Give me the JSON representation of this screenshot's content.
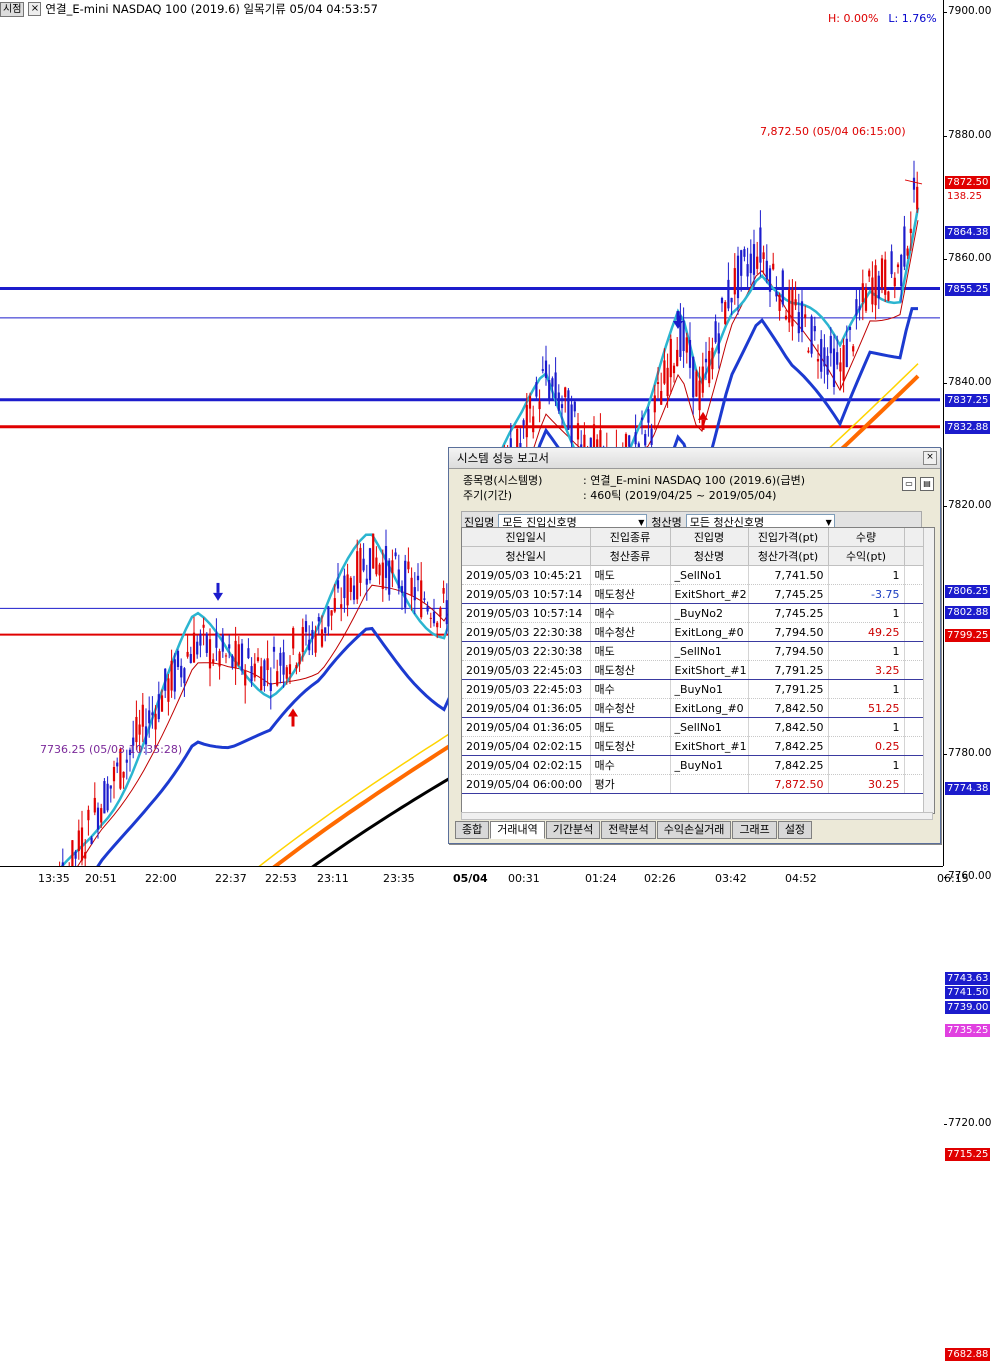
{
  "window": {
    "tag": "시점",
    "close": "×",
    "title": "연결_E-mini NASDAQ 100 (2019.6) 일목기류  05/04 04:53:57"
  },
  "hl": {
    "high": "H: 0.00%",
    "low": "L: 1.76%"
  },
  "annotations": {
    "last_price": "7,872.50 (05/04 06:15:00)",
    "low_price": "7736.25 (05/03 10:35:28)"
  },
  "y_axis": {
    "labels": [
      "7900.00",
      "7880.00",
      "7860.00",
      "7840.00",
      "7820.00",
      "7780.00",
      "7760.00",
      "7720.00"
    ],
    "badges": [
      {
        "text": "7872.50",
        "color": "#e00000"
      },
      {
        "text": "138.25",
        "color": "#ffffff"
      },
      {
        "text": "7864.38",
        "color": "#1c1ccc"
      },
      {
        "text": "7855.25",
        "color": "#1c1ccc"
      },
      {
        "text": "7837.25",
        "color": "#1c1ccc"
      },
      {
        "text": "7832.88",
        "color": "#1c1ccc"
      },
      {
        "text": "7806.25",
        "color": "#1c1ccc"
      },
      {
        "text": "7802.88",
        "color": "#1c1ccc"
      },
      {
        "text": "7799.25",
        "color": "#e00000"
      },
      {
        "text": "7774.38",
        "color": "#1c1ccc"
      },
      {
        "text": "7743.63",
        "color": "#1c1ccc"
      },
      {
        "text": "7741.50",
        "color": "#1c1ccc"
      },
      {
        "text": "7739.00",
        "color": "#1c1ccc"
      },
      {
        "text": "7735.25",
        "color": "#e040e0"
      },
      {
        "text": "7715.25",
        "color": "#e00000"
      },
      {
        "text": "7682.88",
        "color": "#e00000"
      }
    ]
  },
  "x_axis": {
    "labels": [
      "13:35",
      "20:51",
      "22:00",
      "22:37",
      "22:53",
      "23:11",
      "23:35",
      "05/04",
      "00:31",
      "01:24",
      "02:26",
      "03:42",
      "04:52"
    ],
    "corner": "06:15"
  },
  "dialog": {
    "title": "시스템 성능 보고서",
    "close": "×",
    "item_key": "종목명(시스템명)",
    "item_val": ": 연결_E-mini NASDAQ 100 (2019.6)(급변)",
    "period_key": "주기(기간)",
    "period_val": ": 460틱 (2019/04/25 ~ 2019/05/04)",
    "entry_label": "진입명",
    "entry_value": "모든 진입신호명",
    "exit_label": "청산명",
    "exit_value": "모든 청산신호명",
    "headers_top": [
      "진입일시",
      "진입종류",
      "진입명",
      "진입가격(pt)",
      "수량"
    ],
    "headers_bottom": [
      "청산일시",
      "청산종류",
      "청산명",
      "청산가격(pt)",
      "수익(pt)"
    ],
    "rows": [
      [
        "2019/05/03 10:45:21",
        "매도",
        "_SellNo1",
        "7,741.50",
        "1",
        ""
      ],
      [
        "2019/05/03 10:57:14",
        "매도청산",
        "ExitShort_#2",
        "7,745.25",
        "-3.75",
        "neg"
      ],
      [
        "2019/05/03 10:57:14",
        "매수",
        "_BuyNo2",
        "7,745.25",
        "1",
        ""
      ],
      [
        "2019/05/03 22:30:38",
        "매수청산",
        "ExitLong_#0",
        "7,794.50",
        "49.25",
        "pos"
      ],
      [
        "2019/05/03 22:30:38",
        "매도",
        "_SellNo1",
        "7,794.50",
        "1",
        ""
      ],
      [
        "2019/05/03 22:45:03",
        "매도청산",
        "ExitShort_#1",
        "7,791.25",
        "3.25",
        "pos"
      ],
      [
        "2019/05/03 22:45:03",
        "매수",
        "_BuyNo1",
        "7,791.25",
        "1",
        ""
      ],
      [
        "2019/05/04 01:36:05",
        "매수청산",
        "ExitLong_#0",
        "7,842.50",
        "51.25",
        "pos"
      ],
      [
        "2019/05/04 01:36:05",
        "매도",
        "_SellNo1",
        "7,842.50",
        "1",
        ""
      ],
      [
        "2019/05/04 02:02:15",
        "매도청산",
        "ExitShort_#1",
        "7,842.25",
        "0.25",
        "pos"
      ],
      [
        "2019/05/04 02:02:15",
        "매수",
        "_BuyNo1",
        "7,842.25",
        "1",
        ""
      ],
      [
        "2019/05/04 06:00:00",
        "평가",
        "",
        "7,872.50",
        "30.25",
        "eval"
      ]
    ],
    "tabs": [
      "종합",
      "거래내역",
      "기간분석",
      "전략분석",
      "수익손실거래",
      "그래프",
      "설정"
    ],
    "active_tab": 1
  }
}
